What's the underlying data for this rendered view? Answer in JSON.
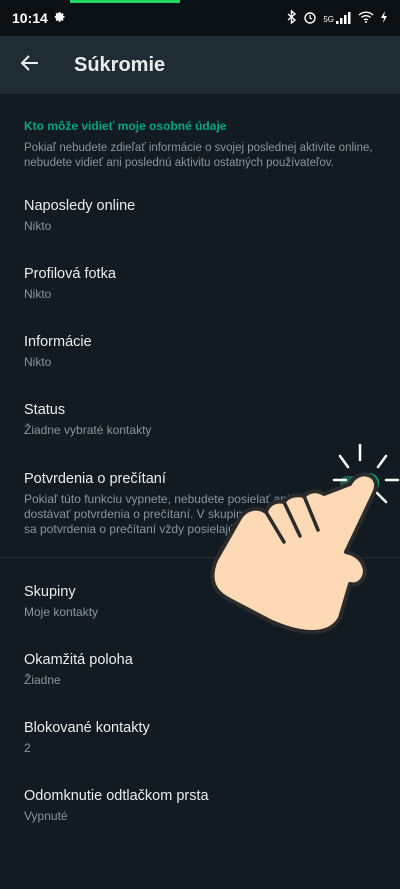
{
  "statusbar": {
    "time": "10:14",
    "signal_label": "5G"
  },
  "appbar": {
    "title": "Súkromie"
  },
  "section": {
    "header": "Kto môže vidieť moje osobné údaje",
    "description": "Pokiaľ nebudete zdieľať informácie o svojej poslednej aktivite online, nebudete vidieť ani poslednú aktivitu ostatných používateľov."
  },
  "items": [
    {
      "title": "Naposledy online",
      "subtitle": "Nikto"
    },
    {
      "title": "Profilová fotka",
      "subtitle": "Nikto"
    },
    {
      "title": "Informácie",
      "subtitle": "Nikto"
    },
    {
      "title": "Status",
      "subtitle": "Žiadne vybraté kontakty"
    },
    {
      "title": "Potvrdenia o prečítaní",
      "subtitle": "Pokiaľ túto funkciu vypnete, nebudete posielať ani dostávať potvrdenia o prečítaní. V skupinových chatoch sa potvrdenia o prečítaní vždy posielajú."
    },
    {
      "title": "Skupiny",
      "subtitle": "Moje kontakty"
    },
    {
      "title": "Okamžitá poloha",
      "subtitle": "Žiadne"
    },
    {
      "title": "Blokované kontakty",
      "subtitle": "2"
    },
    {
      "title": "Odomknutie odtlačkom prsta",
      "subtitle": "Vypnuté"
    }
  ],
  "read_receipts_enabled": true,
  "colors": {
    "accent": "#00a884",
    "background": "#111b21",
    "appbar": "#202c33"
  }
}
